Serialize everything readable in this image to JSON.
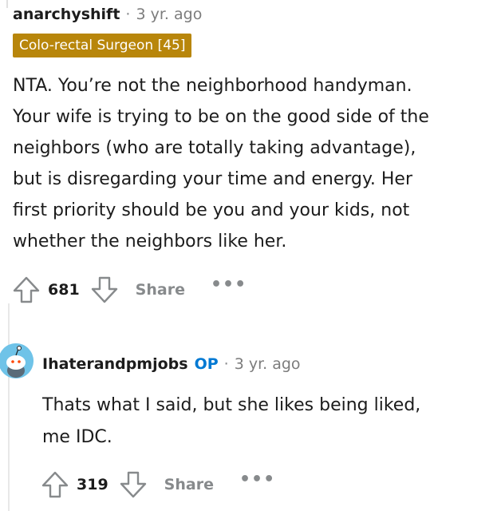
{
  "comment1": {
    "author": "anarchyshift",
    "separator": "·",
    "time": "3 yr. ago",
    "flair": "Colo-rectal Surgeon [45]",
    "flair_color": "#b8860b",
    "lines": [
      "NTA. You’re not the neighborhood handyman.",
      "Your wife is trying to be on the good side of the",
      "neighbors (who are totally taking advantage),",
      "but is disregarding your time and energy. Her",
      "first priority should be you and your kids, not",
      "whether the neighbors like her."
    ],
    "score": "681",
    "share_label": "Share",
    "more_label": "•••"
  },
  "comment2": {
    "author": "Ihaterandpmjobs",
    "op_label": "OP",
    "op_color": "#0079d3",
    "separator": "·",
    "time": "3 yr. ago",
    "lines": [
      "Thats what I said, but she likes being liked,",
      "me IDC."
    ],
    "score": "319",
    "share_label": "Share",
    "more_label": "•••"
  },
  "icons": {
    "upvote": "upvote-arrow-icon",
    "downvote": "downvote-arrow-icon",
    "avatar": "snoo-avatar-icon"
  }
}
